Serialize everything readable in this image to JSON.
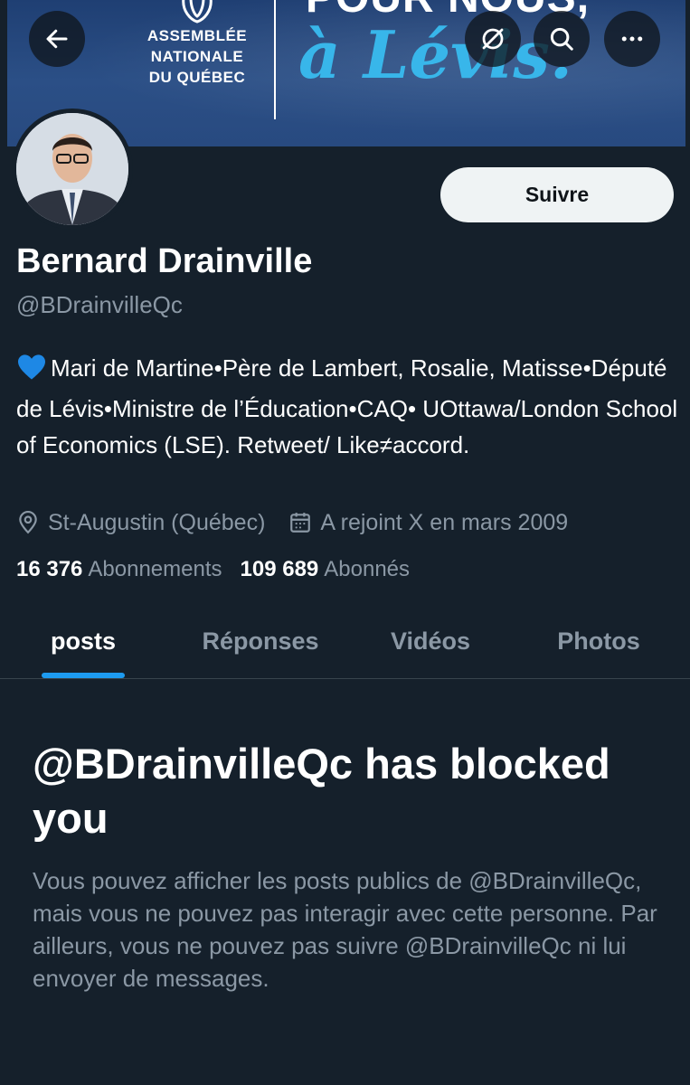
{
  "banner": {
    "logo_lines": [
      "ASSEMBLÉE",
      "NATIONALE",
      "DU QUÉBEC"
    ],
    "headline_top": "POUR NOUS,",
    "headline_script": "à Lévis."
  },
  "top_bar": {
    "back_icon": "arrow-left-icon",
    "grok_icon": "slashed-circle-icon",
    "search_icon": "search-icon",
    "more_icon": "more-horizontal-icon"
  },
  "profile": {
    "name": "Bernard Drainville",
    "handle": "@BDrainvilleQc",
    "follow_label": "Suivre",
    "bio_emoji": "blue-heart-icon",
    "bio": "Mari de Martine•Père de Lambert, Rosalie, Matisse•Député de Lévis•Ministre de l’Éducation•CAQ• UOttawa/London School of Economics (LSE). Retweet/ Like≠accord.",
    "location": "St-Augustin (Québec)",
    "joined": "A rejoint X en mars 2009",
    "following_count": "16 376",
    "following_label": "Abonnements",
    "followers_count": "109 689",
    "followers_label": "Abonnés"
  },
  "tabs": [
    {
      "label": "posts",
      "active": true
    },
    {
      "label": "Réponses",
      "active": false
    },
    {
      "label": "Vidéos",
      "active": false
    },
    {
      "label": "Photos",
      "active": false
    }
  ],
  "blocked": {
    "title": "@BDrainvilleQc has blocked you",
    "description": "Vous pouvez afficher les posts publics de @BDrainvilleQc, mais vous ne pouvez pas interagir avec cette personne. Par ailleurs, vous ne pouvez pas suivre @BDrainvilleQc ni lui envoyer de messages."
  },
  "colors": {
    "background": "#15202b",
    "accent": "#1d9bf0",
    "secondary_text": "#8b98a5"
  }
}
